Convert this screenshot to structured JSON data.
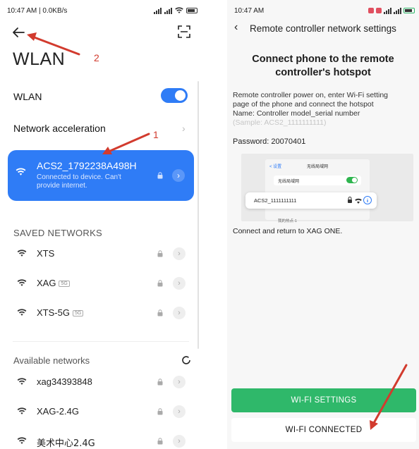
{
  "colors": {
    "accent_blue": "#2f7cf6",
    "accent_green": "#2fb86a",
    "annotation_red": "#d23b2e"
  },
  "left": {
    "status": {
      "time": "10:47 AM | 0.0KB/s",
      "icons": [
        "signal-icon",
        "signal-icon",
        "wifi-icon",
        "battery-icon"
      ]
    },
    "title": "WLAN",
    "annotation_1": "1",
    "annotation_2": "2",
    "wlan_label": "WLAN",
    "wlan_enabled": true,
    "network_acceleration_label": "Network acceleration",
    "connected": {
      "ssid": "ACS2_1792238A498H",
      "status": "Connected to device. Can't provide internet."
    },
    "saved_header": "SAVED NETWORKS",
    "saved": [
      {
        "name": "XTS",
        "tag": ""
      },
      {
        "name": "XAG",
        "tag": "5G"
      },
      {
        "name": "XTS-5G",
        "tag": "5G"
      }
    ],
    "available_header": "Available networks",
    "available": [
      {
        "name": "xag34393848"
      },
      {
        "name": "XAG-2.4G"
      },
      {
        "name": "美术中心2.4G"
      }
    ]
  },
  "right": {
    "status": {
      "time": "10:47 AM"
    },
    "header_title": "Remote controller network settings",
    "heading_line1": "Connect phone to the remote",
    "heading_line2": "controller's hotspot",
    "instructions_line1": "Remote controller power on, enter Wi-Fi setting",
    "instructions_line2": "page of the phone and connect the hotspot",
    "instructions_line3": "Name: Controller model_serial number",
    "sample": "(Sample: ACS2_1111111111)",
    "password": "Password: 20070401",
    "illustration": {
      "back": "< 设置",
      "title": "无线局域网",
      "wlan_row": "无线局域网",
      "card_ssid": "ACS2_1111111111",
      "hotspot_row": "我的热点-1"
    },
    "footer_note": "Connect and return to XAG ONE.",
    "wifi_settings_button": "WI-FI SETTINGS",
    "wifi_connected_button": "WI-FI CONNECTED"
  }
}
